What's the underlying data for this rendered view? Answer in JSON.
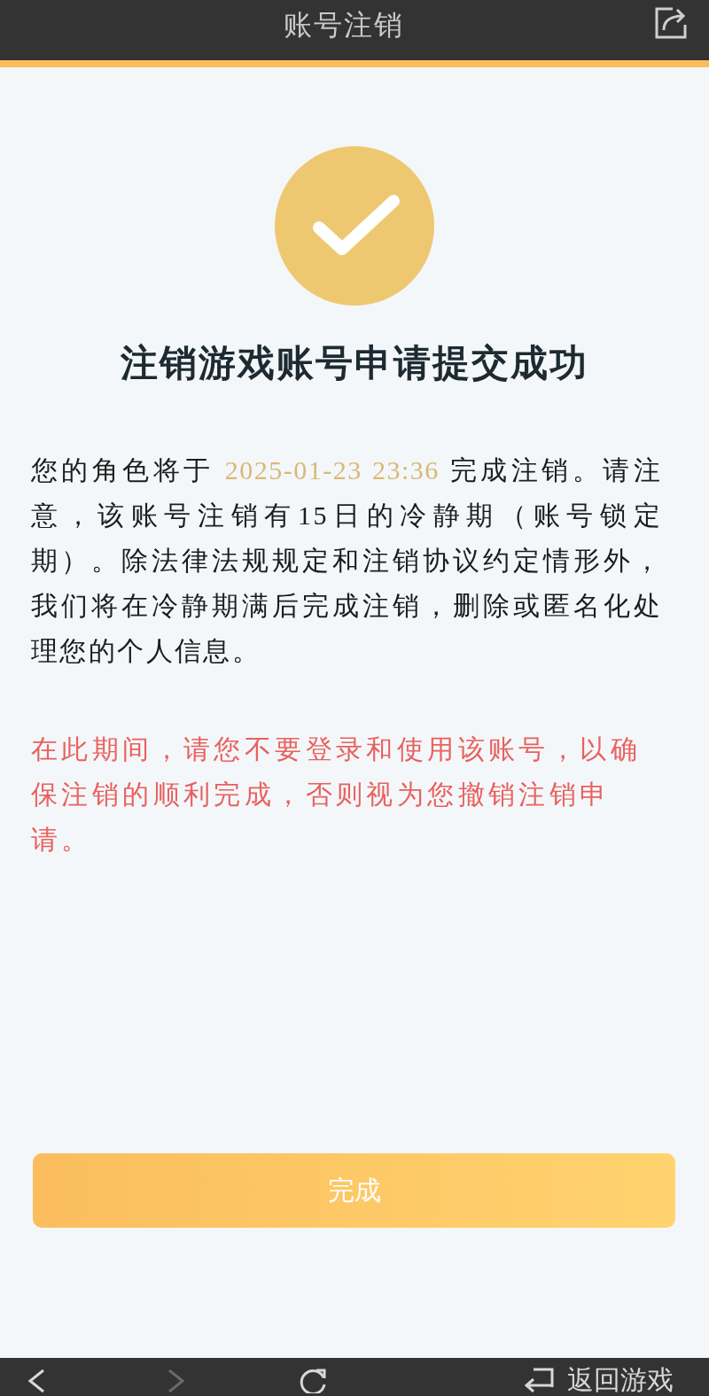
{
  "header": {
    "title": "账号注销"
  },
  "heading": "注销游戏账号申请提交成功",
  "notice": {
    "text_before": "您的角色将于 ",
    "date": "2025-01-23 23:36",
    "text_after": " 完成注销。请注意，该账号注销有15日的冷静期（账号锁定期）。除法律法规规定和注销协议约定情形外，我们将在冷静期满后完成注销，删除或匿名化处理您的个人信息。"
  },
  "warning": "在此期间，请您不要登录和使用该账号，以确保注销的顺利完成，否则视为您撤销注销申请。",
  "primary_button": {
    "label": "完成"
  },
  "bottom_bar": {
    "back": {
      "disabled": false
    },
    "forward": {
      "disabled": true
    },
    "return_label": "返回游戏"
  }
}
